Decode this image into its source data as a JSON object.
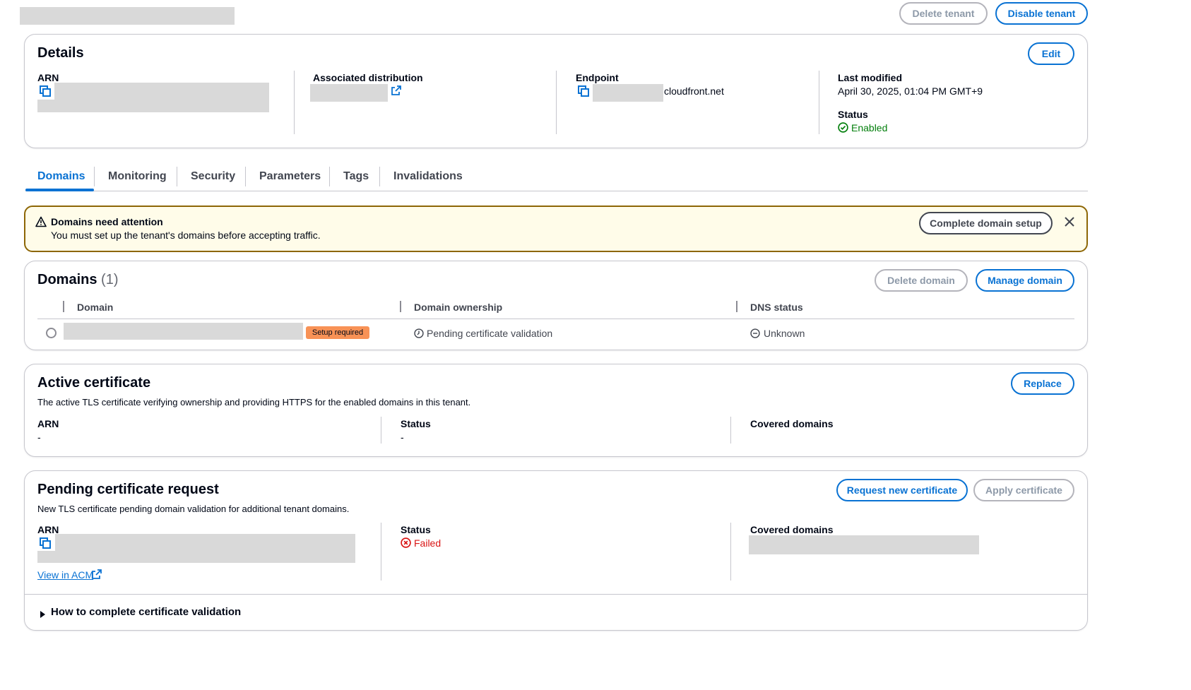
{
  "header": {
    "delete_tenant": "Delete tenant",
    "disable_tenant": "Disable tenant"
  },
  "details": {
    "title": "Details",
    "edit": "Edit",
    "arn_label": "ARN",
    "assoc_label": "Associated distribution",
    "endpoint_label": "Endpoint",
    "endpoint_suffix": "cloudfront.net",
    "last_modified_label": "Last modified",
    "last_modified_value": "April 30, 2025, 01:04 PM GMT+9",
    "status_label": "Status",
    "status_value": "Enabled"
  },
  "tabs": [
    "Domains",
    "Monitoring",
    "Security",
    "Parameters",
    "Tags",
    "Invalidations"
  ],
  "alert": {
    "title": "Domains need attention",
    "message": "You must set up the tenant's domains before accepting traffic.",
    "action": "Complete domain setup"
  },
  "domains": {
    "title": "Domains",
    "count": "(1)",
    "delete": "Delete domain",
    "manage": "Manage domain",
    "columns": [
      "Domain",
      "Domain ownership",
      "DNS status"
    ],
    "row": {
      "badge": "Setup required",
      "ownership": "Pending certificate validation",
      "dns": "Unknown"
    }
  },
  "active_cert": {
    "title": "Active certificate",
    "description": "The active TLS certificate verifying ownership and providing HTTPS for the enabled domains in this tenant.",
    "replace": "Replace",
    "arn_label": "ARN",
    "arn_value": "-",
    "status_label": "Status",
    "status_value": "-",
    "covered_label": "Covered domains"
  },
  "pending_cert": {
    "title": "Pending certificate request",
    "description": "New TLS certificate pending domain validation for additional tenant domains.",
    "request": "Request new certificate",
    "apply": "Apply certificate",
    "arn_label": "ARN",
    "view_acm": "View in ACM",
    "status_label": "Status",
    "status_value": "Failed",
    "covered_label": "Covered domains",
    "expand": "How to complete certificate validation"
  },
  "colors": {
    "link": "#0972d3",
    "success": "#037f0c",
    "error": "#d91515",
    "warning_bg": "#fffce9",
    "warning_border": "#8d6605",
    "badge": "#f89256"
  }
}
